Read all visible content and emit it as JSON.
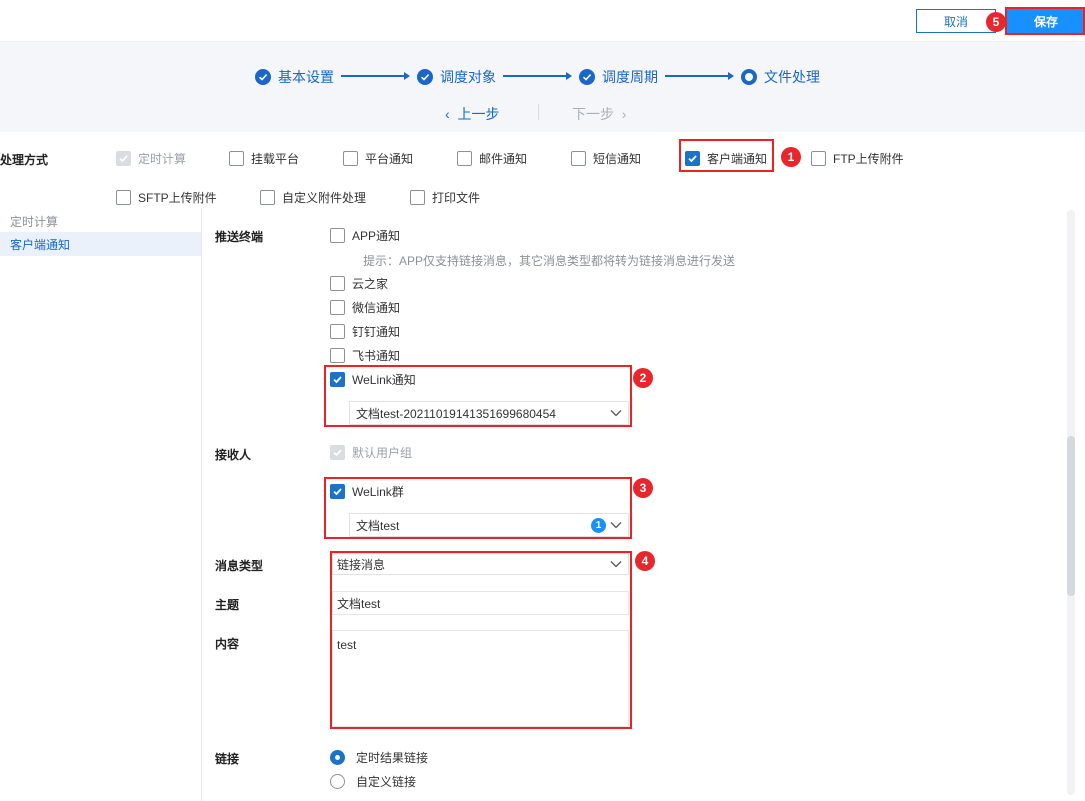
{
  "toolbar": {
    "cancel_label": "取消",
    "save_label": "保存"
  },
  "steps": [
    {
      "label": "基本设置",
      "state": "done"
    },
    {
      "label": "调度对象",
      "state": "done"
    },
    {
      "label": "调度周期",
      "state": "done"
    },
    {
      "label": "文件处理",
      "state": "current"
    }
  ],
  "nav": {
    "prev": "上一步",
    "next": "下一步"
  },
  "processing": {
    "label": "处理方式",
    "options": [
      {
        "label": "定时计算",
        "checked": true,
        "disabled": true
      },
      {
        "label": "挂载平台",
        "checked": false
      },
      {
        "label": "平台通知",
        "checked": false
      },
      {
        "label": "邮件通知",
        "checked": false
      },
      {
        "label": "短信通知",
        "checked": false
      },
      {
        "label": "客户端通知",
        "checked": true
      },
      {
        "label": "FTP上传附件",
        "checked": false
      },
      {
        "label": "SFTP上传附件",
        "checked": false
      },
      {
        "label": "自定义附件处理",
        "checked": false
      },
      {
        "label": "打印文件",
        "checked": false
      }
    ]
  },
  "leftnav": {
    "title": "定时计算",
    "active": "客户端通知"
  },
  "push": {
    "label": "推送终端",
    "terminals": [
      {
        "label": "APP通知",
        "checked": false
      },
      {
        "label": "云之家",
        "checked": false
      },
      {
        "label": "微信通知",
        "checked": false
      },
      {
        "label": "钉钉通知",
        "checked": false
      },
      {
        "label": "飞书通知",
        "checked": false
      },
      {
        "label": "WeLink通知",
        "checked": true
      }
    ],
    "hint": "提示：APP仅支持链接消息，其它消息类型都将转为链接消息进行发送",
    "welink_select": "文档test-20211019141351699680454"
  },
  "receiver": {
    "label": "接收人",
    "default_group": "默认用户组",
    "welink_group": "WeLink群",
    "group_select": "文档test",
    "group_count": "1"
  },
  "message": {
    "type_label": "消息类型",
    "type_value": "链接消息",
    "subject_label": "主题",
    "subject_value": "文档test",
    "content_label": "内容",
    "content_value": "test"
  },
  "link": {
    "label": "链接",
    "options": [
      {
        "label": "定时结果链接",
        "selected": true
      },
      {
        "label": "自定义链接",
        "selected": false
      }
    ]
  },
  "annotations": [
    "1",
    "2",
    "3",
    "4",
    "5"
  ],
  "colors": {
    "primary": "#1a73c8",
    "save": "#1890ff",
    "highlight": "#e22222",
    "marker": "#e8262b"
  }
}
